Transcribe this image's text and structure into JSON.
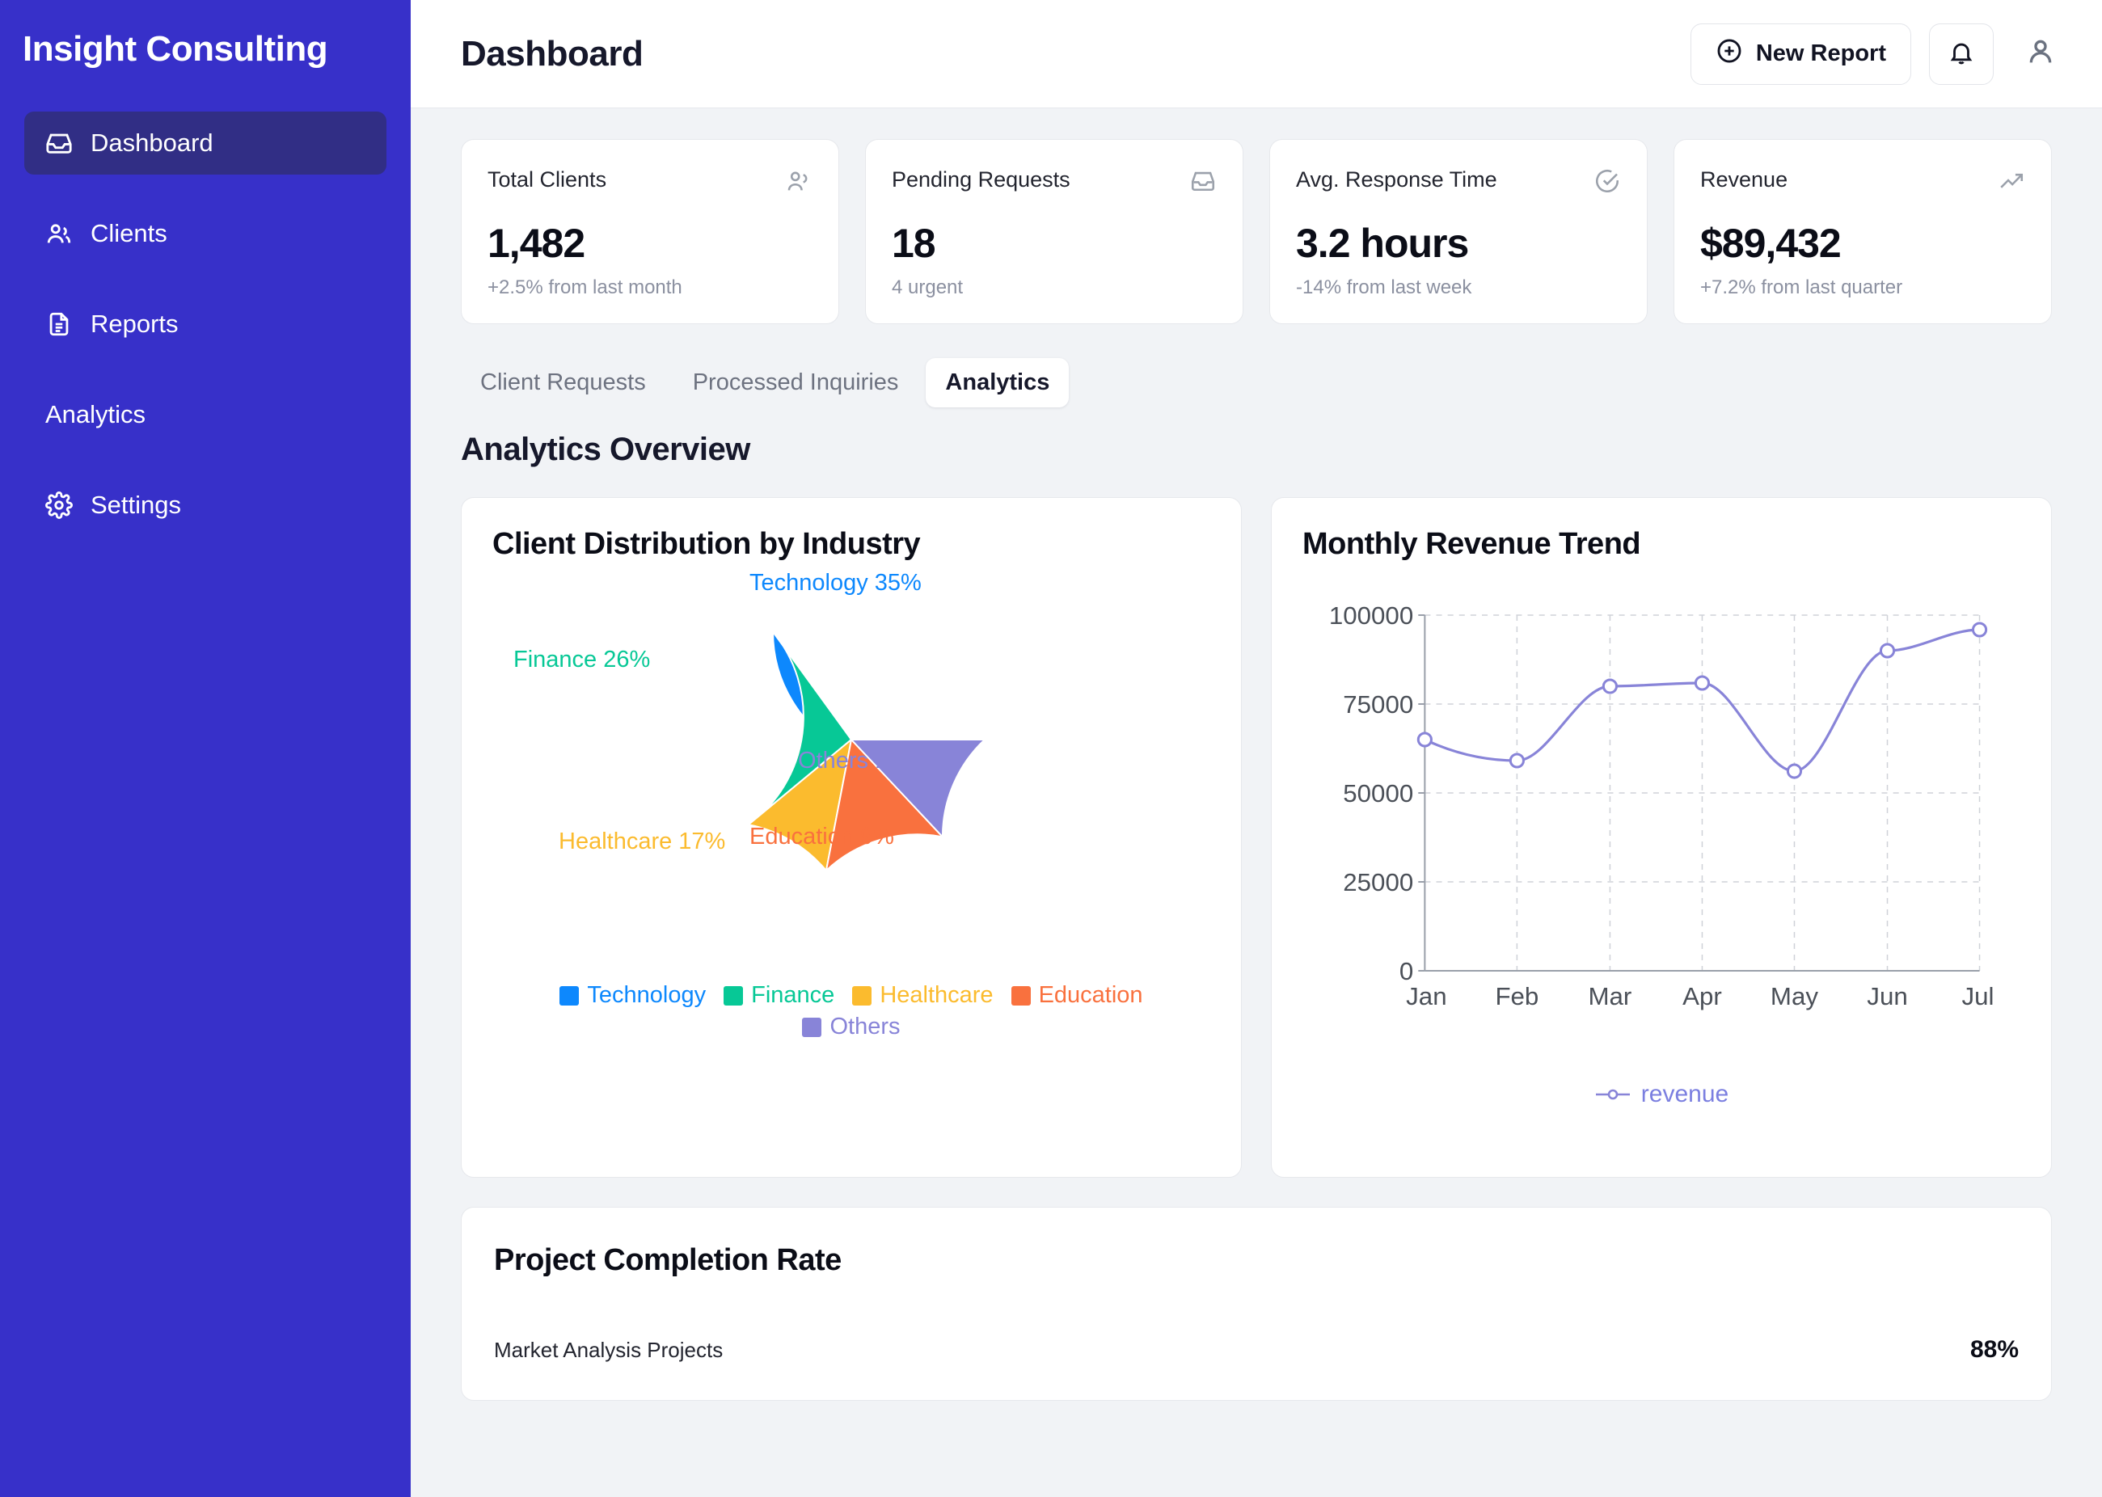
{
  "sidebar": {
    "brand": "Insight Consulting",
    "items": [
      {
        "label": "Dashboard",
        "icon": "inbox-icon",
        "active": true
      },
      {
        "label": "Clients",
        "icon": "users-icon",
        "active": false
      },
      {
        "label": "Reports",
        "icon": "document-icon",
        "active": false
      },
      {
        "label": "Analytics",
        "icon": "none",
        "active": false
      },
      {
        "label": "Settings",
        "icon": "gear-icon",
        "active": false
      }
    ],
    "bg_color": "#3730c9",
    "active_color": "#312e85"
  },
  "header": {
    "title": "Dashboard",
    "new_report_label": "New Report",
    "new_report_icon": "plus-circle-icon",
    "notifications_icon": "bell-icon",
    "avatar_icon": "user-icon"
  },
  "stats": [
    {
      "label": "Total Clients",
      "value": "1,482",
      "sub": "+2.5% from last month",
      "icon": "users-icon"
    },
    {
      "label": "Pending Requests",
      "value": "18",
      "sub": "4 urgent",
      "icon": "inbox-icon"
    },
    {
      "label": "Avg. Response Time",
      "value": "3.2 hours",
      "sub": "-14% from last week",
      "icon": "check-circle-icon"
    },
    {
      "label": "Revenue",
      "value": "$89,432",
      "sub": "+7.2% from last quarter",
      "icon": "trending-up-icon"
    }
  ],
  "tabs": [
    {
      "label": "Client Requests",
      "active": false
    },
    {
      "label": "Processed Inquiries",
      "active": false
    },
    {
      "label": "Analytics",
      "active": true
    }
  ],
  "section": {
    "title": "Analytics Overview"
  },
  "bottom": {
    "title": "Project Completion Rate",
    "rows": [
      {
        "name": "Market Analysis Projects",
        "pct": "88%"
      }
    ]
  },
  "chart_data": [
    {
      "type": "pie",
      "title": "Client Distribution by Industry",
      "categories": [
        "Technology",
        "Finance",
        "Healthcare",
        "Education",
        "Others"
      ],
      "values": [
        35,
        26,
        17,
        9,
        13
      ],
      "labels": [
        "Technology 35%",
        "Finance 26%",
        "Healthcare 17%",
        "Education 9%",
        "Others 13%"
      ],
      "colors": [
        "#0d88fd",
        "#07c896",
        "#fbbb2e",
        "#f9713e",
        "#8884d8"
      ],
      "legend": [
        "Technology",
        "Finance",
        "Healthcare",
        "Education",
        "Others"
      ],
      "legend_position": "bottom",
      "grid": false
    },
    {
      "type": "line",
      "title": "Monthly Revenue Trend",
      "x": [
        "Jan",
        "Feb",
        "Mar",
        "Apr",
        "May",
        "Jun",
        "Jul"
      ],
      "series": [
        {
          "name": "revenue",
          "values": [
            65000,
            59000,
            80000,
            81000,
            56000,
            90000,
            96000
          ],
          "color": "#8884d8"
        }
      ],
      "xlabel": "",
      "ylabel": "",
      "ylim": [
        0,
        100000
      ],
      "yticks": [
        0,
        25000,
        50000,
        75000,
        100000
      ],
      "ytick_labels": [
        "0",
        "25000",
        "50000",
        "75000",
        "100000"
      ],
      "legend": [
        "revenue"
      ],
      "legend_position": "bottom",
      "grid": true
    }
  ]
}
